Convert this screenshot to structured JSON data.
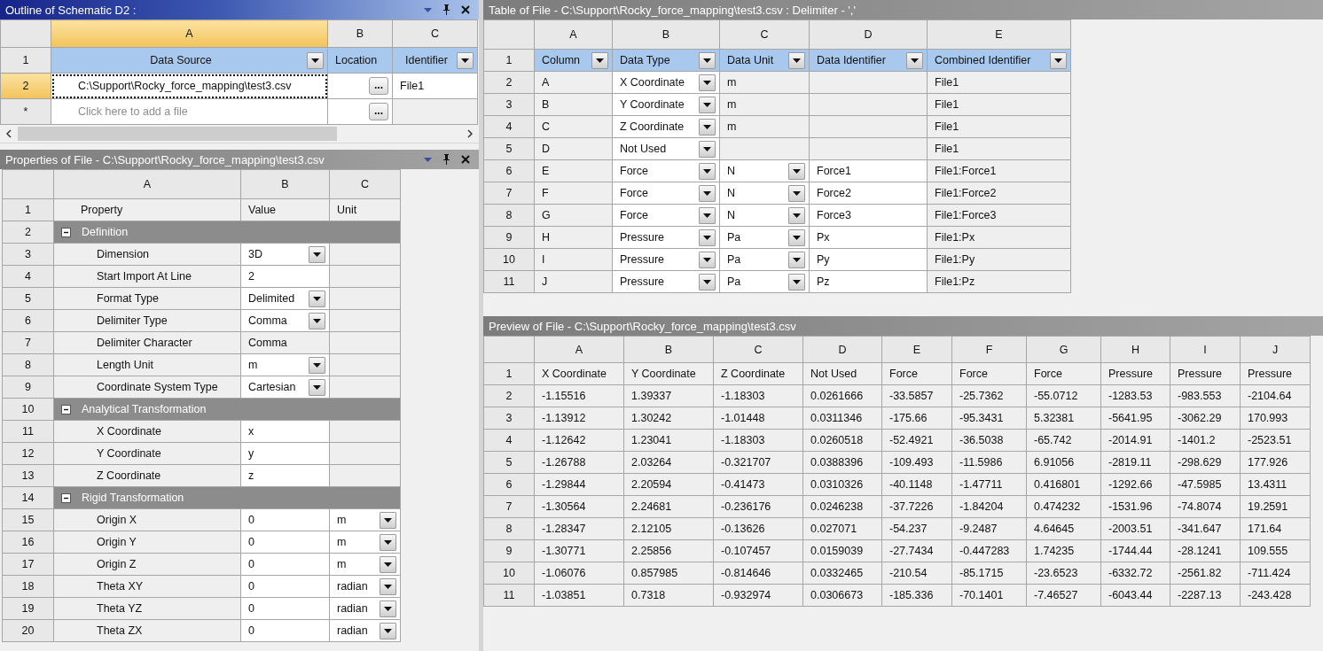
{
  "outline": {
    "title": "Outline of Schematic D2 :",
    "active": true,
    "controls": true,
    "columns": [
      {
        "label": "A",
        "selected": true
      },
      {
        "label": "B",
        "selected": false
      },
      {
        "label": "C",
        "selected": false
      }
    ],
    "rows": [
      {
        "label": "1",
        "selected": false,
        "cells": [
          {
            "kind": "filter",
            "text": "Data Source"
          },
          {
            "kind": "heading",
            "text": "Location"
          },
          {
            "kind": "filter",
            "text": "Identifier"
          }
        ]
      },
      {
        "label": "2",
        "selected": true,
        "cells": [
          {
            "kind": "field",
            "text": "C:\\Support\\Rocky_force_mapping\\test3.csv"
          },
          {
            "kind": "browse",
            "button": "..."
          },
          {
            "kind": "field",
            "text": "File1"
          }
        ]
      },
      {
        "label": "*",
        "selected": false,
        "cells": [
          {
            "kind": "field",
            "placeholder": "Click here to add a file"
          },
          {
            "kind": "browse",
            "button": "..."
          },
          {
            "kind": "plain"
          }
        ]
      }
    ]
  },
  "properties": {
    "title": "Properties of File - C:\\Support\\Rocky_force_mapping\\test3.csv",
    "active": false,
    "controls": true,
    "columns": [
      {
        "label": "A"
      },
      {
        "label": "B"
      },
      {
        "label": "C"
      }
    ],
    "rows": [
      {
        "label": "1",
        "cells": [
          {
            "kind": "indent",
            "text": "Property"
          },
          {
            "kind": "plain",
            "text": "Value"
          },
          {
            "kind": "plain",
            "text": "Unit"
          }
        ]
      },
      {
        "label": "2",
        "kind": "group",
        "text": "Definition",
        "expanded": true
      },
      {
        "label": "3",
        "cells": [
          {
            "kind": "property",
            "text": "Dimension"
          },
          {
            "kind": "dropdown",
            "text": "3D"
          },
          {
            "kind": "plain"
          }
        ]
      },
      {
        "label": "4",
        "cells": [
          {
            "kind": "property",
            "text": "Start Import At Line"
          },
          {
            "kind": "field",
            "text": "2"
          },
          {
            "kind": "plain"
          }
        ]
      },
      {
        "label": "5",
        "cells": [
          {
            "kind": "property",
            "text": "Format Type"
          },
          {
            "kind": "dropdown",
            "text": "Delimited"
          },
          {
            "kind": "plain"
          }
        ]
      },
      {
        "label": "6",
        "cells": [
          {
            "kind": "property",
            "text": "Delimiter Type"
          },
          {
            "kind": "dropdown",
            "text": "Comma"
          },
          {
            "kind": "plain"
          }
        ]
      },
      {
        "label": "7",
        "cells": [
          {
            "kind": "property",
            "text": "Delimiter Character"
          },
          {
            "kind": "plain",
            "text": "Comma"
          },
          {
            "kind": "plain"
          }
        ]
      },
      {
        "label": "8",
        "cells": [
          {
            "kind": "property",
            "text": "Length Unit"
          },
          {
            "kind": "dropdown",
            "text": "m"
          },
          {
            "kind": "plain"
          }
        ]
      },
      {
        "label": "9",
        "cells": [
          {
            "kind": "property",
            "text": "Coordinate System Type"
          },
          {
            "kind": "dropdown",
            "text": "Cartesian"
          },
          {
            "kind": "plain"
          }
        ]
      },
      {
        "label": "10",
        "kind": "group",
        "text": "Analytical Transformation",
        "expanded": true
      },
      {
        "label": "11",
        "cells": [
          {
            "kind": "property",
            "text": "X Coordinate"
          },
          {
            "kind": "field",
            "text": "x"
          },
          {
            "kind": "plain"
          }
        ]
      },
      {
        "label": "12",
        "cells": [
          {
            "kind": "property",
            "text": "Y Coordinate"
          },
          {
            "kind": "field",
            "text": "y"
          },
          {
            "kind": "plain"
          }
        ]
      },
      {
        "label": "13",
        "cells": [
          {
            "kind": "property",
            "text": "Z Coordinate"
          },
          {
            "kind": "field",
            "text": "z"
          },
          {
            "kind": "plain"
          }
        ]
      },
      {
        "label": "14",
        "kind": "group",
        "text": "Rigid Transformation",
        "expanded": true
      },
      {
        "label": "15",
        "cells": [
          {
            "kind": "property",
            "text": "Origin X"
          },
          {
            "kind": "field",
            "text": "0"
          },
          {
            "kind": "dropdown",
            "text": "m"
          }
        ]
      },
      {
        "label": "16",
        "cells": [
          {
            "kind": "property",
            "text": "Origin Y"
          },
          {
            "kind": "field",
            "text": "0"
          },
          {
            "kind": "dropdown",
            "text": "m"
          }
        ]
      },
      {
        "label": "17",
        "cells": [
          {
            "kind": "property",
            "text": "Origin Z"
          },
          {
            "kind": "field",
            "text": "0"
          },
          {
            "kind": "dropdown",
            "text": "m"
          }
        ]
      },
      {
        "label": "18",
        "cells": [
          {
            "kind": "property",
            "text": "Theta XY"
          },
          {
            "kind": "field",
            "text": "0"
          },
          {
            "kind": "dropdown",
            "text": "radian"
          }
        ]
      },
      {
        "label": "19",
        "cells": [
          {
            "kind": "property",
            "text": "Theta YZ"
          },
          {
            "kind": "field",
            "text": "0"
          },
          {
            "kind": "dropdown",
            "text": "radian"
          }
        ]
      },
      {
        "label": "20",
        "cells": [
          {
            "kind": "property",
            "text": "Theta ZX"
          },
          {
            "kind": "field",
            "text": "0"
          },
          {
            "kind": "dropdown",
            "text": "radian"
          }
        ]
      }
    ]
  },
  "file_table": {
    "title": "Table of File - C:\\Support\\Rocky_force_mapping\\test3.csv : Delimiter - ','",
    "active": false,
    "controls": false,
    "columns": [
      {
        "label": "A"
      },
      {
        "label": "B"
      },
      {
        "label": "C"
      },
      {
        "label": "D"
      },
      {
        "label": "E"
      }
    ],
    "rows": [
      {
        "label": "1",
        "cells": [
          {
            "kind": "filter",
            "text": "Column"
          },
          {
            "kind": "filter",
            "text": "Data Type"
          },
          {
            "kind": "filter",
            "text": "Data Unit"
          },
          {
            "kind": "filter",
            "text": "Data Identifier"
          },
          {
            "kind": "filter",
            "text": "Combined Identifier"
          }
        ]
      },
      {
        "label": "2",
        "cells": [
          {
            "kind": "plain",
            "text": "A"
          },
          {
            "kind": "dropdown",
            "text": "X Coordinate"
          },
          {
            "kind": "plain",
            "text": "m"
          },
          {
            "kind": "plain"
          },
          {
            "kind": "plain",
            "text": "File1"
          }
        ]
      },
      {
        "label": "3",
        "cells": [
          {
            "kind": "plain",
            "text": "B"
          },
          {
            "kind": "dropdown",
            "text": "Y Coordinate"
          },
          {
            "kind": "plain",
            "text": "m"
          },
          {
            "kind": "plain"
          },
          {
            "kind": "plain",
            "text": "File1"
          }
        ]
      },
      {
        "label": "4",
        "cells": [
          {
            "kind": "plain",
            "text": "C"
          },
          {
            "kind": "dropdown",
            "text": "Z Coordinate"
          },
          {
            "kind": "plain",
            "text": "m"
          },
          {
            "kind": "plain"
          },
          {
            "kind": "plain",
            "text": "File1"
          }
        ]
      },
      {
        "label": "5",
        "cells": [
          {
            "kind": "plain",
            "text": "D"
          },
          {
            "kind": "dropdown",
            "text": "Not Used"
          },
          {
            "kind": "plain"
          },
          {
            "kind": "plain"
          },
          {
            "kind": "plain",
            "text": "File1"
          }
        ]
      },
      {
        "label": "6",
        "cells": [
          {
            "kind": "plain",
            "text": "E"
          },
          {
            "kind": "dropdown",
            "text": "Force"
          },
          {
            "kind": "dropdown",
            "text": "N"
          },
          {
            "kind": "field",
            "text": "Force1"
          },
          {
            "kind": "plain",
            "text": "File1:Force1"
          }
        ]
      },
      {
        "label": "7",
        "cells": [
          {
            "kind": "plain",
            "text": "F"
          },
          {
            "kind": "dropdown",
            "text": "Force"
          },
          {
            "kind": "dropdown",
            "text": "N"
          },
          {
            "kind": "field",
            "text": "Force2"
          },
          {
            "kind": "plain",
            "text": "File1:Force2"
          }
        ]
      },
      {
        "label": "8",
        "cells": [
          {
            "kind": "plain",
            "text": "G"
          },
          {
            "kind": "dropdown",
            "text": "Force"
          },
          {
            "kind": "dropdown",
            "text": "N"
          },
          {
            "kind": "field",
            "text": "Force3"
          },
          {
            "kind": "plain",
            "text": "File1:Force3"
          }
        ]
      },
      {
        "label": "9",
        "cells": [
          {
            "kind": "plain",
            "text": "H"
          },
          {
            "kind": "dropdown",
            "text": "Pressure"
          },
          {
            "kind": "dropdown",
            "text": "Pa"
          },
          {
            "kind": "field",
            "text": "Px"
          },
          {
            "kind": "plain",
            "text": "File1:Px"
          }
        ]
      },
      {
        "label": "10",
        "cells": [
          {
            "kind": "plain",
            "text": "I"
          },
          {
            "kind": "dropdown",
            "text": "Pressure"
          },
          {
            "kind": "dropdown",
            "text": "Pa"
          },
          {
            "kind": "field",
            "text": "Py"
          },
          {
            "kind": "plain",
            "text": "File1:Py"
          }
        ]
      },
      {
        "label": "11",
        "cells": [
          {
            "kind": "plain",
            "text": "J"
          },
          {
            "kind": "dropdown",
            "text": "Pressure"
          },
          {
            "kind": "dropdown",
            "text": "Pa"
          },
          {
            "kind": "field",
            "text": "Pz"
          },
          {
            "kind": "plain",
            "text": "File1:Pz"
          }
        ]
      }
    ]
  },
  "preview": {
    "title": "Preview of File - C:\\Support\\Rocky_force_mapping\\test3.csv",
    "active": false,
    "controls": false,
    "columns": [
      {
        "label": "A"
      },
      {
        "label": "B"
      },
      {
        "label": "C"
      },
      {
        "label": "D"
      },
      {
        "label": "E"
      },
      {
        "label": "F"
      },
      {
        "label": "G"
      },
      {
        "label": "H"
      },
      {
        "label": "I"
      },
      {
        "label": "J"
      }
    ],
    "rows": [
      {
        "label": "1",
        "cells": [
          "X Coordinate",
          "Y Coordinate",
          "Z Coordinate",
          "Not Used",
          "Force",
          "Force",
          "Force",
          "Pressure",
          "Pressure",
          "Pressure"
        ]
      },
      {
        "label": "2",
        "cells": [
          "-1.15516",
          "1.39337",
          "-1.18303",
          "0.0261666",
          "-33.5857",
          "-25.7362",
          "-55.0712",
          "-1283.53",
          "-983.553",
          "-2104.64"
        ]
      },
      {
        "label": "3",
        "cells": [
          "-1.13912",
          "1.30242",
          "-1.01448",
          "0.0311346",
          "-175.66",
          "-95.3431",
          "5.32381",
          "-5641.95",
          "-3062.29",
          "170.993"
        ]
      },
      {
        "label": "4",
        "cells": [
          "-1.12642",
          "1.23041",
          "-1.18303",
          "0.0260518",
          "-52.4921",
          "-36.5038",
          "-65.742",
          "-2014.91",
          "-1401.2",
          "-2523.51"
        ]
      },
      {
        "label": "5",
        "cells": [
          "-1.26788",
          "2.03264",
          "-0.321707",
          "0.0388396",
          "-109.493",
          "-11.5986",
          "6.91056",
          "-2819.11",
          "-298.629",
          "177.926"
        ]
      },
      {
        "label": "6",
        "cells": [
          "-1.29844",
          "2.20594",
          "-0.41473",
          "0.0310326",
          "-40.1148",
          "-1.47711",
          "0.416801",
          "-1292.66",
          "-47.5985",
          "13.4311"
        ]
      },
      {
        "label": "7",
        "cells": [
          "-1.30564",
          "2.24681",
          "-0.236176",
          "0.0246238",
          "-37.7226",
          "-1.84204",
          "0.474232",
          "-1531.96",
          "-74.8074",
          "19.2591"
        ]
      },
      {
        "label": "8",
        "cells": [
          "-1.28347",
          "2.12105",
          "-0.13626",
          "0.027071",
          "-54.237",
          "-9.2487",
          "4.64645",
          "-2003.51",
          "-341.647",
          "171.64"
        ]
      },
      {
        "label": "9",
        "cells": [
          "-1.30771",
          "2.25856",
          "-0.107457",
          "0.0159039",
          "-27.7434",
          "-0.447283",
          "1.74235",
          "-1744.44",
          "-28.1241",
          "109.555"
        ]
      },
      {
        "label": "10",
        "cells": [
          "-1.06076",
          "0.857985",
          "-0.814646",
          "0.0332465",
          "-210.54",
          "-85.1715",
          "-23.6523",
          "-6332.72",
          "-2561.82",
          "-711.424"
        ]
      },
      {
        "label": "11",
        "cells": [
          "-1.03851",
          "0.7318",
          "-0.932974",
          "0.0306673",
          "-185.336",
          "-70.1401",
          "-7.46527",
          "-6043.44",
          "-2287.13",
          "-243.428"
        ]
      }
    ]
  }
}
